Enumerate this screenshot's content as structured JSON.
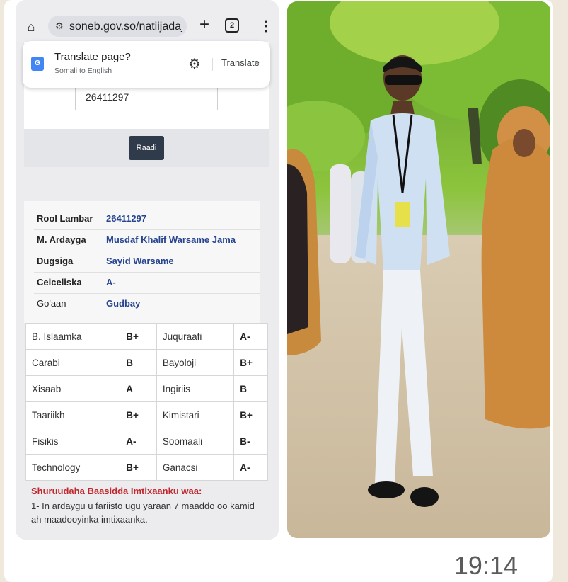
{
  "browser": {
    "url": "soneb.gov.so/natiijada_",
    "tab_count": "2"
  },
  "translate_bar": {
    "title": "Translate page?",
    "subtitle": "Somali to English",
    "button": "Translate"
  },
  "search": {
    "input_value": "26411297",
    "button_label": "Raadi"
  },
  "student": {
    "rows": [
      {
        "label": "Rool Lambar",
        "value": "26411297"
      },
      {
        "label": "M. Ardayga",
        "value": "Musdaf Khalif Warsame Jama"
      },
      {
        "label": "Dugsiga",
        "value": "Sayid Warsame"
      },
      {
        "label": "Celceliska",
        "value": "A-"
      },
      {
        "label": "Go'aan",
        "value": "Gudbay"
      }
    ]
  },
  "grades": [
    [
      "B. Islaamka",
      "B+",
      "Juquraafi",
      "A-"
    ],
    [
      "Carabi",
      "B",
      "Bayoloji",
      "B+"
    ],
    [
      "Xisaab",
      "A",
      "Ingiriis",
      "B"
    ],
    [
      "Taariikh",
      "B+",
      "Kimistari",
      "B+"
    ],
    [
      "Fisikis",
      "A-",
      "Soomaali",
      "B-"
    ],
    [
      "Technology",
      "B+",
      "Ganacsi",
      "A-"
    ]
  ],
  "requirements": {
    "title": "Shuruudaha Baasidda Imtixaanku waa:",
    "text": "1- In ardaygu u fariisto ugu yaraan 7 maaddo oo kamid ah maadooyinka imtixaanka."
  },
  "message": {
    "time": "19:14"
  },
  "colors": {
    "accent_blue": "#26448f",
    "alert_red": "#c0262c",
    "button_dark": "#2f3a4a"
  }
}
